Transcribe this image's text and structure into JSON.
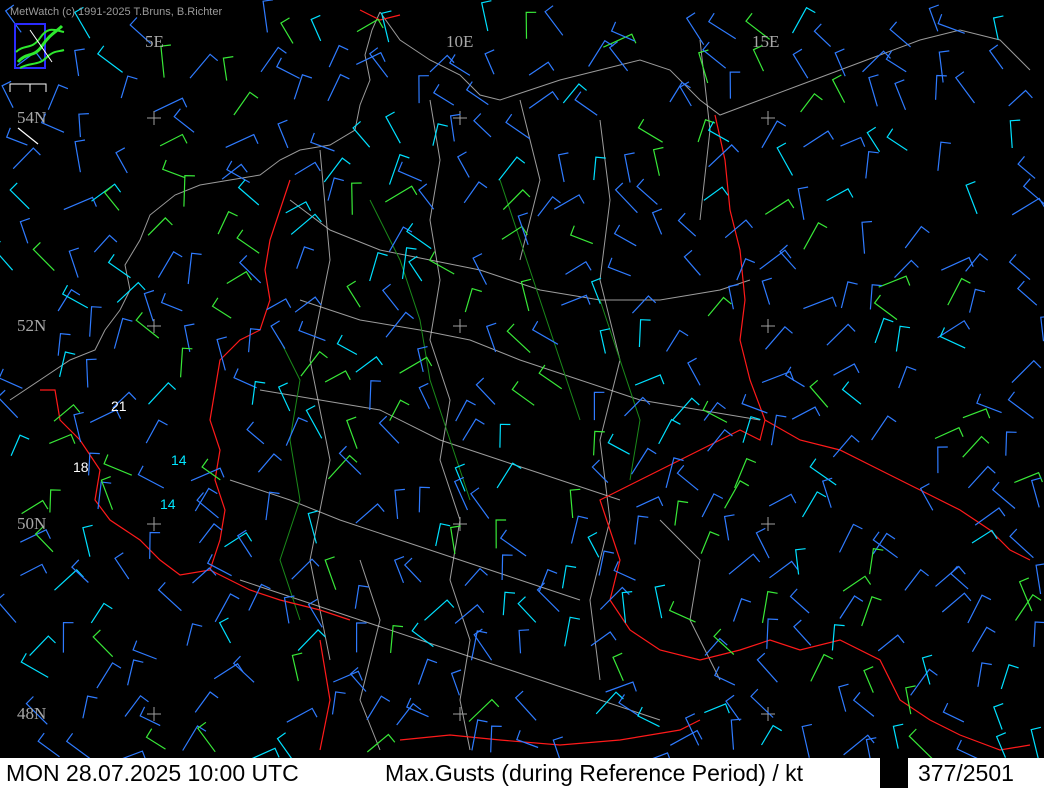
{
  "credit": "MetWatch  (c) 1991-2025 T.Bruns, B.Richter",
  "lon_labels": [
    {
      "text": "5E"
    },
    {
      "text": "10E"
    },
    {
      "text": "15E"
    }
  ],
  "lat_labels": [
    {
      "text": "54N"
    },
    {
      "text": "52N"
    },
    {
      "text": "50N"
    },
    {
      "text": "48N"
    }
  ],
  "stations": [
    {
      "text": "21",
      "color": "#ffffff"
    },
    {
      "text": "14",
      "color": "#00e5ff"
    },
    {
      "text": "18",
      "color": "#ffffff"
    },
    {
      "text": "14",
      "color": "#00e5ff"
    }
  ],
  "colors": {
    "border_red": "#ff1a1a",
    "state_border": "#d0d0d0",
    "rivers_green": "#1a8a1a",
    "barb_blue": "#2f7bff",
    "barb_cyan": "#00e0ff",
    "barb_green": "#38e838",
    "grid_cross": "#a0a0a0"
  },
  "status": {
    "datetime": "MON 28.07.2025 10:00 UTC",
    "parameter": "Max.Gusts (during Reference Period) / kt",
    "frame": "377/2501"
  }
}
